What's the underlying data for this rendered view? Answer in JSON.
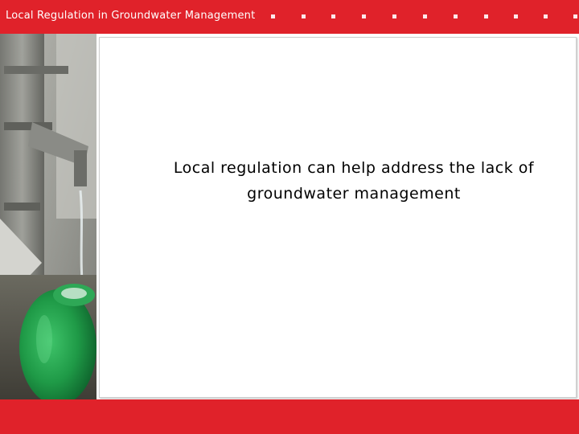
{
  "header": {
    "title": "Local Regulation in Groundwater Management"
  },
  "slide": {
    "body_text": "Local regulation can help address the lack of groundwater management"
  },
  "colors": {
    "accent": "#e0222a",
    "background": "#ffffff",
    "text": "#000000"
  }
}
